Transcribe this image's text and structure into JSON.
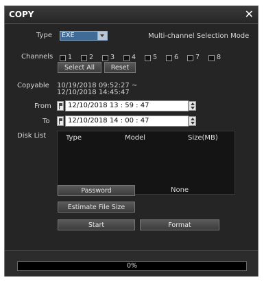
{
  "dialog": {
    "title": "COPY",
    "close_icon": "close-icon"
  },
  "type": {
    "label": "Type",
    "value": "EXE"
  },
  "mode_label": "Multi-channel Selection Mode",
  "channels": {
    "label": "Channels",
    "items": [
      "1",
      "2",
      "3",
      "4",
      "5",
      "6",
      "7",
      "8"
    ]
  },
  "buttons": {
    "select_all": "Select All",
    "reset": "Reset",
    "password": "Password",
    "estimate": "Estimate File Size",
    "start": "Start",
    "format": "Format"
  },
  "copyable": {
    "label": "Copyable",
    "line1": "10/19/2018  09:52:27 ~",
    "line2": "12/10/2018  14:45:47"
  },
  "from": {
    "label": "From",
    "value": "12/10/2018  13 : 59 : 47"
  },
  "to": {
    "label": "To",
    "value": "12/10/2018  14 : 00 : 47"
  },
  "disk_list": {
    "label": "Disk List",
    "columns": [
      "Type",
      "Model",
      "Size(MB)"
    ]
  },
  "password_value": "None",
  "progress": {
    "text": "0%",
    "fraction": 0.0
  },
  "colors": {
    "dialog_bg": "#252525",
    "accent": "#3f6b96"
  }
}
